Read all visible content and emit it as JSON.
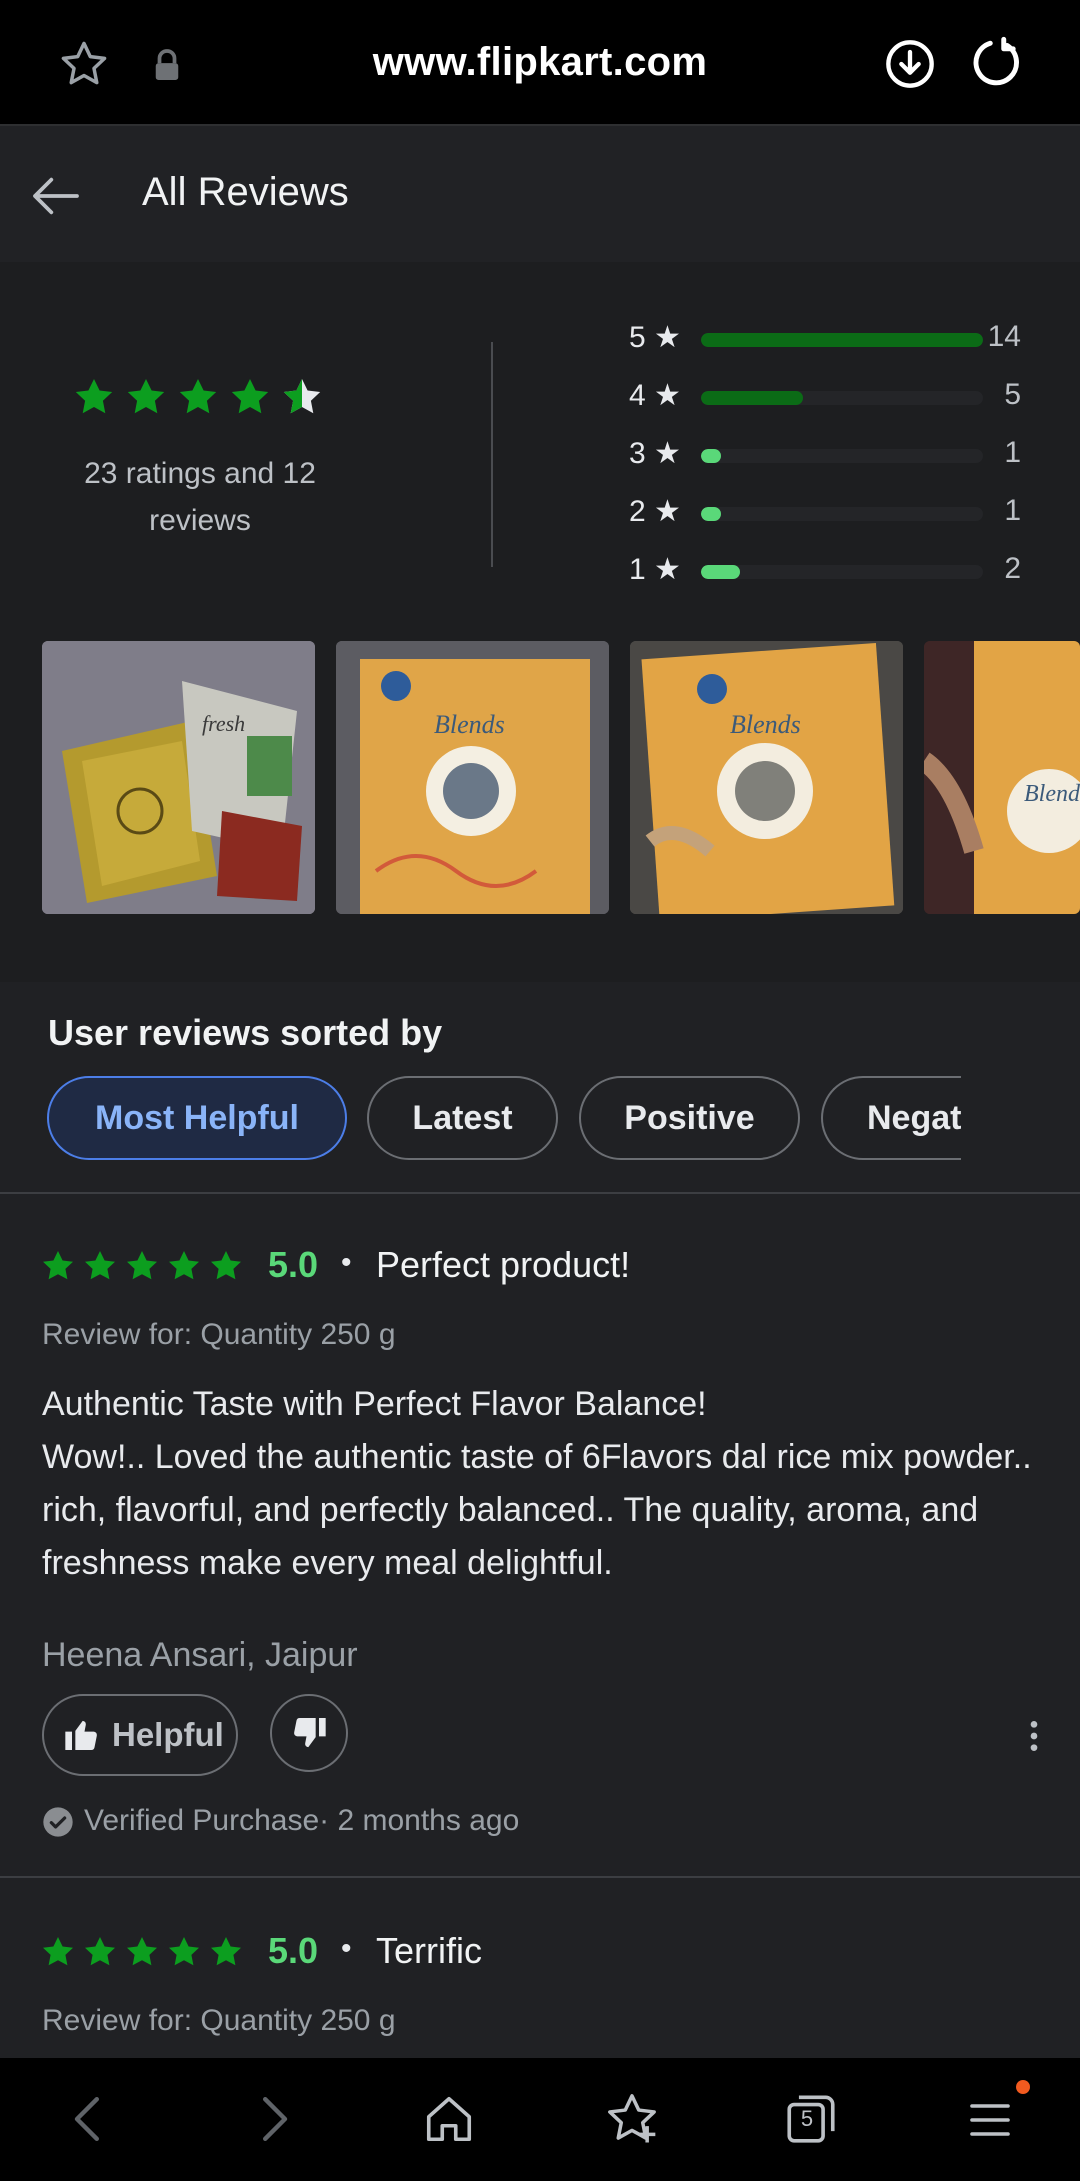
{
  "browser": {
    "url": "www.flipkart.com",
    "tab_count": "5"
  },
  "header": {
    "title": "All Reviews"
  },
  "summary": {
    "average_rating": 4.5,
    "ratings_text": "23 ratings and 12 reviews",
    "histogram": [
      {
        "label": "5 ★",
        "count": "14",
        "fraction": 1.0,
        "color": "#0b6b16"
      },
      {
        "label": "4 ★",
        "count": "5",
        "fraction": 0.36,
        "color": "#0b6b16"
      },
      {
        "label": "3 ★",
        "count": "1",
        "fraction": 0.07,
        "color": "#5ad879"
      },
      {
        "label": "2 ★",
        "count": "1",
        "fraction": 0.07,
        "color": "#5ad879"
      },
      {
        "label": "1 ★",
        "count": "2",
        "fraction": 0.14,
        "color": "#5ad879"
      }
    ]
  },
  "sort": {
    "title": "User reviews sorted by",
    "options": [
      "Most Helpful",
      "Latest",
      "Positive",
      "Negat"
    ]
  },
  "reviews": [
    {
      "score": "5.0",
      "title": "Perfect product!",
      "review_for": "Review for: Quantity 250 g",
      "body_line1": "Authentic Taste with Perfect Flavor Balance!",
      "body_line2": "Wow!.. Loved the authentic taste of 6Flavors dal rice mix powder.. rich, flavorful, and perfectly balanced.. The quality, aroma, and freshness make every meal delightful.",
      "author": "Heena Ansari, Jaipur",
      "helpful_label": "Helpful",
      "verified": "Verified Purchase· 2 months ago"
    },
    {
      "score": "5.0",
      "title": "Terrific",
      "review_for": "Review for: Quantity 250 g"
    }
  ],
  "colors": {
    "star_green": "#0c9e1f",
    "score_green": "#5ad879",
    "accent_blue": "#8ab4f8"
  }
}
